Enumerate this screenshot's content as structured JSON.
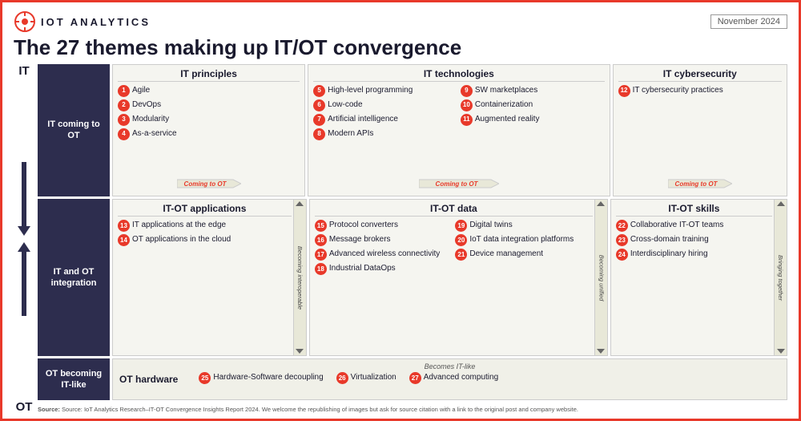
{
  "header": {
    "logo_text": "IOT ANALYTICS",
    "date": "November 2024"
  },
  "title": "The 27 themes making up IT/OT convergence",
  "axis": {
    "top": "IT",
    "bottom": "OT"
  },
  "rows": [
    {
      "label": "IT coming to OT",
      "cells": [
        {
          "header": "IT principles",
          "columns": [
            [
              {
                "num": "1",
                "text": "Agile"
              },
              {
                "num": "2",
                "text": "DevOps"
              },
              {
                "num": "3",
                "text": "Modularity"
              },
              {
                "num": "4",
                "text": "As-a-service"
              }
            ]
          ],
          "footer": "Coming to OT"
        },
        {
          "header": "IT technologies",
          "columns": [
            [
              {
                "num": "5",
                "text": "High-level programming"
              },
              {
                "num": "6",
                "text": "Low-code"
              },
              {
                "num": "7",
                "text": "Artificial intelligence"
              },
              {
                "num": "8",
                "text": "Modern APIs"
              }
            ],
            [
              {
                "num": "9",
                "text": "SW marketplaces"
              },
              {
                "num": "10",
                "text": "Containerization"
              },
              {
                "num": "11",
                "text": "Augmented reality"
              }
            ]
          ],
          "footer": "Coming to OT"
        },
        {
          "header": "IT cybersecurity",
          "columns": [
            [
              {
                "num": "12",
                "text": "IT cybersecurity practices"
              }
            ]
          ],
          "footer": "Coming to OT"
        }
      ]
    },
    {
      "label": "IT and OT integration",
      "cells": [
        {
          "header": "IT-OT applications",
          "columns": [
            [
              {
                "num": "13",
                "text": "IT applications at the edge"
              },
              {
                "num": "14",
                "text": "OT applications in the cloud"
              }
            ]
          ],
          "side_label": "Becoming interoperable"
        },
        {
          "header": "IT-OT data",
          "columns": [
            [
              {
                "num": "15",
                "text": "Protocol converters"
              },
              {
                "num": "16",
                "text": "Message brokers"
              },
              {
                "num": "17",
                "text": "Advanced wireless connectivity"
              },
              {
                "num": "18",
                "text": "Industrial DataOps"
              }
            ],
            [
              {
                "num": "19",
                "text": "Digital twins"
              },
              {
                "num": "20",
                "text": "IoT data integration platforms"
              },
              {
                "num": "21",
                "text": "Device management"
              }
            ]
          ],
          "side_label": "Becoming unified"
        },
        {
          "header": "IT-OT skills",
          "columns": [
            [
              {
                "num": "22",
                "text": "Collaborative IT-OT teams"
              },
              {
                "num": "23",
                "text": "Cross-domain training"
              },
              {
                "num": "24",
                "text": "Interdisciplinary hiring"
              }
            ]
          ],
          "side_label": "Bringing together"
        }
      ]
    }
  ],
  "bottom_row": {
    "label": "OT becoming IT-like",
    "becomes_label": "Becomes IT-like",
    "section_title": "OT hardware",
    "items": [
      {
        "num": "25",
        "text": "Hardware-Software decoupling"
      },
      {
        "num": "26",
        "text": "Virtualization"
      },
      {
        "num": "27",
        "text": "Advanced computing"
      }
    ]
  },
  "source": "Source: IoT Analytics Research–IT-OT Convergence Insights Report 2024. We welcome the republishing of images but ask for source citation with a link to the original post and company website."
}
